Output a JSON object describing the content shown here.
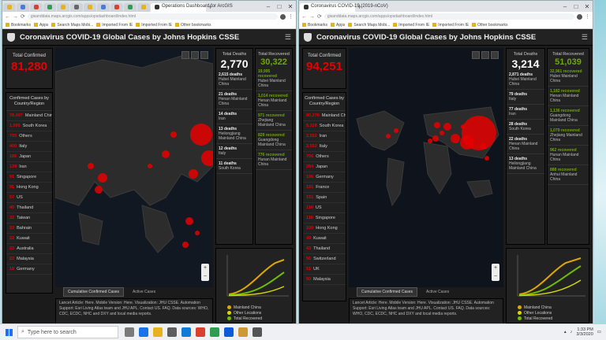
{
  "left": {
    "tab_title": "Operations Dashboard for ArcGIS",
    "address": "gisanddata.maps.arcgis.com/apps/opsdashboard/index.html",
    "bookmarks": [
      "Bookmarks",
      "Apps",
      "Search Maps Mobi...",
      "Imported From IE",
      "Imported From IE",
      "Other bookmarks"
    ],
    "dashboard_title": "Coronavirus COVID-19 Global Cases by Johns Hopkins CSSE",
    "total_confirmed_label": "Total Confirmed",
    "total_confirmed": "81,280",
    "list_header": "Confirmed Cases by Country/Region",
    "countries": [
      {
        "count": "78,497",
        "name": "Mainland China"
      },
      {
        "count": "1,595",
        "name": "South Korea"
      },
      {
        "count": "705",
        "name": "Others"
      },
      {
        "count": "400",
        "name": "Italy"
      },
      {
        "count": "186",
        "name": "Japan"
      },
      {
        "count": "139",
        "name": "Iran"
      },
      {
        "count": "91",
        "name": "Singapore"
      },
      {
        "count": "91",
        "name": "Hong Kong"
      },
      {
        "count": "57",
        "name": "US"
      },
      {
        "count": "40",
        "name": "Thailand"
      },
      {
        "count": "32",
        "name": "Taiwan"
      },
      {
        "count": "33",
        "name": "Bahrain"
      },
      {
        "count": "22",
        "name": "Kuwait"
      },
      {
        "count": "23",
        "name": "Australia"
      },
      {
        "count": "22",
        "name": "Malaysia"
      },
      {
        "count": "18",
        "name": "Germany"
      }
    ],
    "total_deaths_label": "Total Deaths",
    "total_deaths": "2,770",
    "deaths_rows": [
      {
        "value": "2,615 deaths",
        "place": "Hubei Mainland China"
      },
      {
        "value": "21 deaths",
        "place": "Henan Mainland China"
      },
      {
        "value": "14 deaths",
        "place": "Iran"
      },
      {
        "value": "13 deaths",
        "place": "Heilongjiang Mainland China"
      },
      {
        "value": "12 deaths",
        "place": "Italy"
      },
      {
        "value": "11 deaths",
        "place": "South Korea"
      }
    ],
    "total_recovered_label": "Total Recovered",
    "total_recovered": "30,322",
    "recovered_rows": [
      {
        "value": "19,995 recovered",
        "place": "Hubei Mainland China"
      },
      {
        "value": "1,014 recovered",
        "place": "Henan Mainland China"
      },
      {
        "value": "971 recovered",
        "place": "Zhejiang Mainland China"
      },
      {
        "value": "829 recovered",
        "place": "Guangdong Mainland China"
      },
      {
        "value": "776 recovered",
        "place": "Hunan Mainland China"
      }
    ],
    "map_tabs": [
      "Cumulative Confirmed Cases",
      "Active Cases"
    ],
    "legend": [
      "Mainland China",
      "Other Locations",
      "Total Recovered"
    ],
    "chart_bottom_label": "Actual",
    "footer": "Lancet Article: Here. Mobile Version: Here. Visualization: JHU CSSE. Automation Support: Esri Living Atlas team and JHU APL. Contact US. FAQ. Data sources: WHO, CDC, ECDC, NHC and DXY and local media reports."
  },
  "right": {
    "tab_title": "Coronavirus COVID-19 (2019-nCoV)",
    "address": "gisanddata.maps.arcgis.com/apps/opsdashboard/index.html",
    "bookmarks": [
      "Bookmarks",
      "Apps",
      "Search Maps Mobi...",
      "Imported From IE",
      "Imported From IE",
      "Other bookmarks"
    ],
    "dashboard_title": "Coronavirus COVID-19 Global Cases by Johns Hopkins CSSE",
    "total_confirmed_label": "Total Confirmed",
    "total_confirmed": "94,251",
    "list_header": "Confirmed Cases by Country/Region",
    "countries": [
      {
        "count": "80,270",
        "name": "Mainland China"
      },
      {
        "count": "5,328",
        "name": "South Korea"
      },
      {
        "count": "2,502",
        "name": "Iran"
      },
      {
        "count": "2,502",
        "name": "Italy"
      },
      {
        "count": "706",
        "name": "Others"
      },
      {
        "count": "284",
        "name": "Japan"
      },
      {
        "count": "196",
        "name": "Germany"
      },
      {
        "count": "191",
        "name": "France"
      },
      {
        "count": "151",
        "name": "Spain"
      },
      {
        "count": "110",
        "name": "US"
      },
      {
        "count": "110",
        "name": "Singapore"
      },
      {
        "count": "100",
        "name": "Hong Kong"
      },
      {
        "count": "49",
        "name": "Kuwait"
      },
      {
        "count": "43",
        "name": "Thailand"
      },
      {
        "count": "56",
        "name": "Switzerland"
      },
      {
        "count": "51",
        "name": "UK"
      },
      {
        "count": "50",
        "name": "Malaysia"
      }
    ],
    "total_deaths_label": "Total Deaths",
    "total_deaths": "3,214",
    "deaths_rows": [
      {
        "value": "2,871 deaths",
        "place": "Hubei Mainland China"
      },
      {
        "value": "79 deaths",
        "place": "Italy"
      },
      {
        "value": "77 deaths",
        "place": "Iran"
      },
      {
        "value": "28 deaths",
        "place": "South Korea"
      },
      {
        "value": "22 deaths",
        "place": "Henan Mainland China"
      },
      {
        "value": "13 deaths",
        "place": "Heilongjiang Mainland China"
      }
    ],
    "total_recovered_label": "Total Recovered",
    "total_recovered": "51,039",
    "recovered_rows": [
      {
        "value": "32,961 recovered",
        "place": "Hubei Mainland China"
      },
      {
        "value": "1,182 recovered",
        "place": "Henan Mainland China"
      },
      {
        "value": "1,136 recovered",
        "place": "Guangdong Mainland China"
      },
      {
        "value": "1,079 recovered",
        "place": "Zhejiang Mainland China"
      },
      {
        "value": "962 recovered",
        "place": "Hunan Mainland China"
      },
      {
        "value": "888 recovered",
        "place": "Anhui Mainland China"
      }
    ],
    "map_tabs": [
      "Cumulative Confirmed Cases",
      "Active Cases"
    ],
    "legend": [
      "Mainland China",
      "Other Locations",
      "Total Recovered"
    ],
    "chart_bottom_label": "Actual",
    "footer": "Lancet Article: Here. Mobile Version: Here. Visualization: JHU CSSE. Automation Support: Esri Living Atlas team and JHU APL. Contact US. FAQ. Data sources: WHO, CDC, ECDC, NHC and DXY and local media reports."
  },
  "colors": {
    "confirmed": "#e60000",
    "recovered": "#70a800",
    "mainland_china": "#e0a800",
    "other_locations": "#d8d800",
    "total_recovered_line": "#6fbf00"
  },
  "taskbar": {
    "search_placeholder": "Type here to search",
    "time": "1:33 PM",
    "date": "3/3/2020"
  }
}
